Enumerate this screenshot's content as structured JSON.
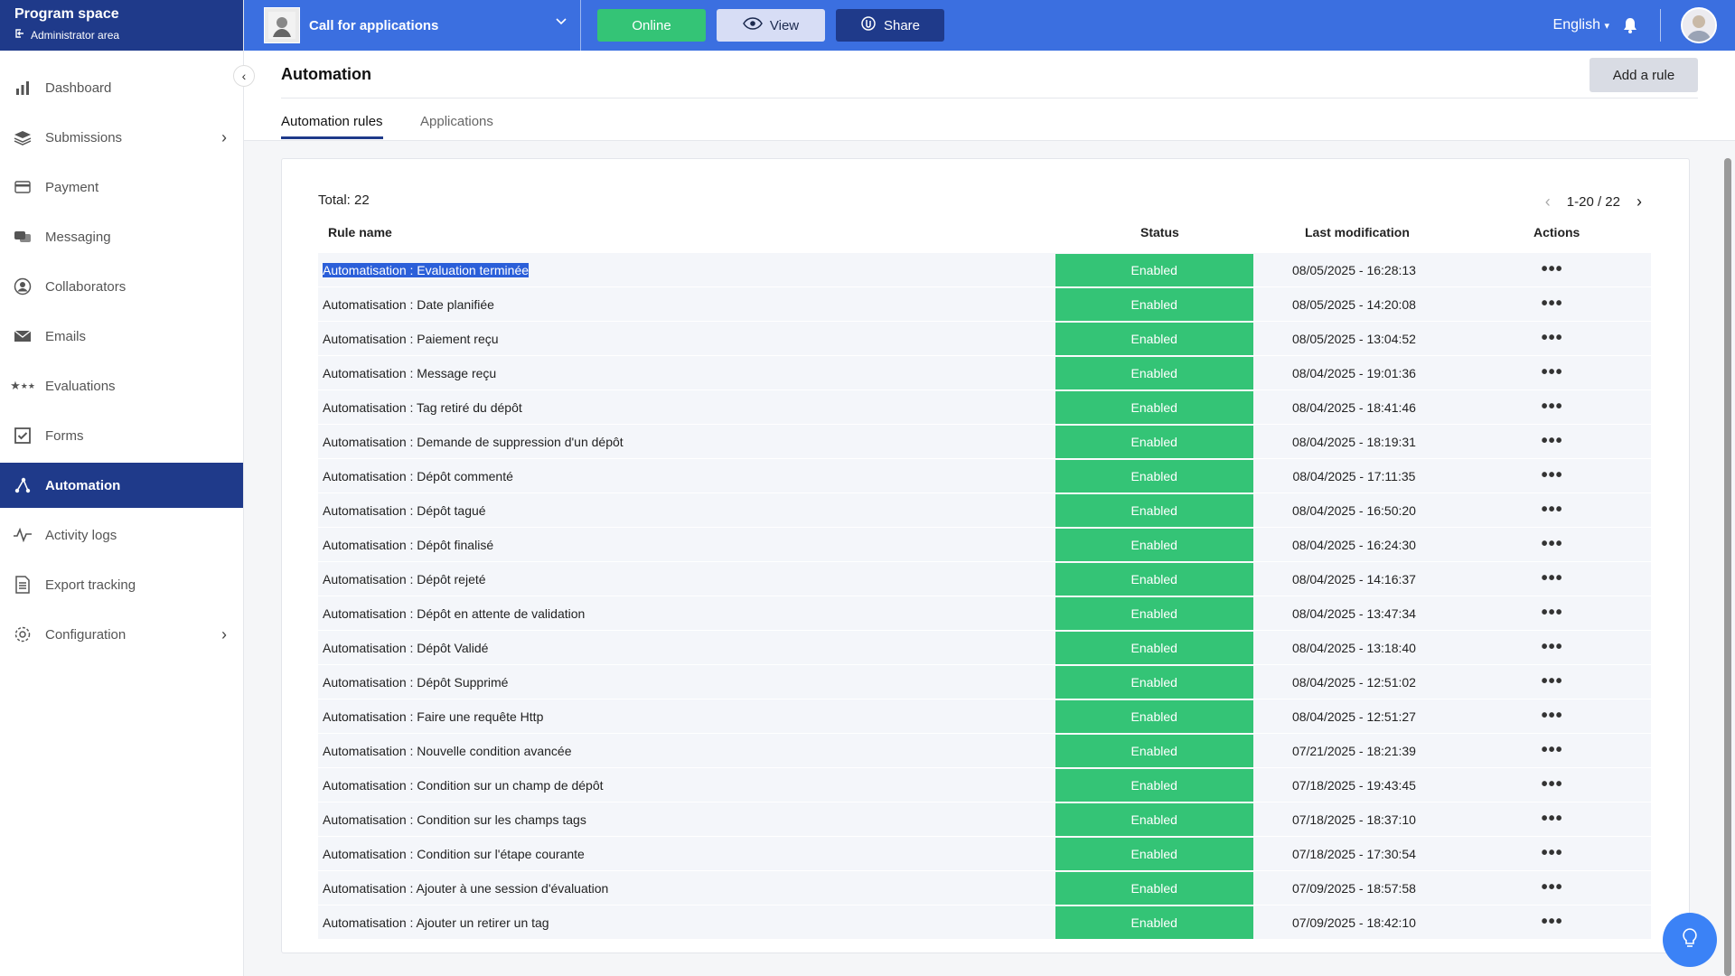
{
  "sidebar": {
    "title": "Program space",
    "subtitle": "Administrator area",
    "items": [
      {
        "label": "Dashboard",
        "icon": "bar-chart-icon"
      },
      {
        "label": "Submissions",
        "icon": "layers-icon"
      },
      {
        "label": "Payment",
        "icon": "credit-card-icon"
      },
      {
        "label": "Messaging",
        "icon": "chat-icon"
      },
      {
        "label": "Collaborators",
        "icon": "user-circle-icon"
      },
      {
        "label": "Emails",
        "icon": "envelope-icon"
      },
      {
        "label": "Evaluations",
        "icon": "stars-icon"
      },
      {
        "label": "Forms",
        "icon": "checkbox-icon"
      },
      {
        "label": "Automation",
        "icon": "automation-icon"
      },
      {
        "label": "Activity logs",
        "icon": "pulse-icon"
      },
      {
        "label": "Export tracking",
        "icon": "document-icon"
      },
      {
        "label": "Configuration",
        "icon": "gear-icon"
      }
    ]
  },
  "topbar": {
    "program_name": "Call for applications",
    "online_label": "Online",
    "view_label": "View",
    "share_label": "Share",
    "language": "English"
  },
  "page": {
    "title": "Automation",
    "add_rule_label": "Add a rule",
    "tabs": [
      {
        "label": "Automation rules"
      },
      {
        "label": "Applications"
      }
    ]
  },
  "table": {
    "total_label": "Total: 22",
    "pagination": "1-20 / 22",
    "columns": {
      "name": "Rule name",
      "status": "Status",
      "modified": "Last modification",
      "actions": "Actions"
    },
    "rows": [
      {
        "name": "Automatisation : Evaluation terminée",
        "status": "Enabled",
        "modified": "08/05/2025 - 16:28:13"
      },
      {
        "name": "Automatisation : Date planifiée",
        "status": "Enabled",
        "modified": "08/05/2025 - 14:20:08"
      },
      {
        "name": "Automatisation : Paiement reçu",
        "status": "Enabled",
        "modified": "08/05/2025 - 13:04:52"
      },
      {
        "name": "Automatisation : Message reçu",
        "status": "Enabled",
        "modified": "08/04/2025 - 19:01:36"
      },
      {
        "name": "Automatisation : Tag retiré du dépôt",
        "status": "Enabled",
        "modified": "08/04/2025 - 18:41:46"
      },
      {
        "name": "Automatisation : Demande de suppression d'un dépôt",
        "status": "Enabled",
        "modified": "08/04/2025 - 18:19:31"
      },
      {
        "name": "Automatisation : Dépôt commenté",
        "status": "Enabled",
        "modified": "08/04/2025 - 17:11:35"
      },
      {
        "name": "Automatisation : Dépôt tagué",
        "status": "Enabled",
        "modified": "08/04/2025 - 16:50:20"
      },
      {
        "name": "Automatisation : Dépôt finalisé",
        "status": "Enabled",
        "modified": "08/04/2025 - 16:24:30"
      },
      {
        "name": "Automatisation : Dépôt rejeté",
        "status": "Enabled",
        "modified": "08/04/2025 - 14:16:37"
      },
      {
        "name": "Automatisation : Dépôt en attente de validation",
        "status": "Enabled",
        "modified": "08/04/2025 - 13:47:34"
      },
      {
        "name": "Automatisation : Dépôt Validé",
        "status": "Enabled",
        "modified": "08/04/2025 - 13:18:40"
      },
      {
        "name": "Automatisation : Dépôt Supprimé",
        "status": "Enabled",
        "modified": "08/04/2025 - 12:51:02"
      },
      {
        "name": "Automatisation : Faire une requête Http",
        "status": "Enabled",
        "modified": "08/04/2025 - 12:51:27"
      },
      {
        "name": "Automatisation : Nouvelle condition avancée",
        "status": "Enabled",
        "modified": "07/21/2025 - 18:21:39"
      },
      {
        "name": "Automatisation : Condition sur un champ de dépôt",
        "status": "Enabled",
        "modified": "07/18/2025 - 19:43:45"
      },
      {
        "name": "Automatisation : Condition sur les champs tags",
        "status": "Enabled",
        "modified": "07/18/2025 - 18:37:10"
      },
      {
        "name": "Automatisation : Condition sur l'étape courante",
        "status": "Enabled",
        "modified": "07/18/2025 - 17:30:54"
      },
      {
        "name": "Automatisation : Ajouter à une session d'évaluation",
        "status": "Enabled",
        "modified": "07/09/2025 - 18:57:58"
      },
      {
        "name": "Automatisation : Ajouter un retirer un tag",
        "status": "Enabled",
        "modified": "07/09/2025 - 18:42:10"
      }
    ]
  },
  "colors": {
    "primary": "#3b6fe0",
    "navy": "#1f3a8a",
    "success": "#34c476"
  }
}
